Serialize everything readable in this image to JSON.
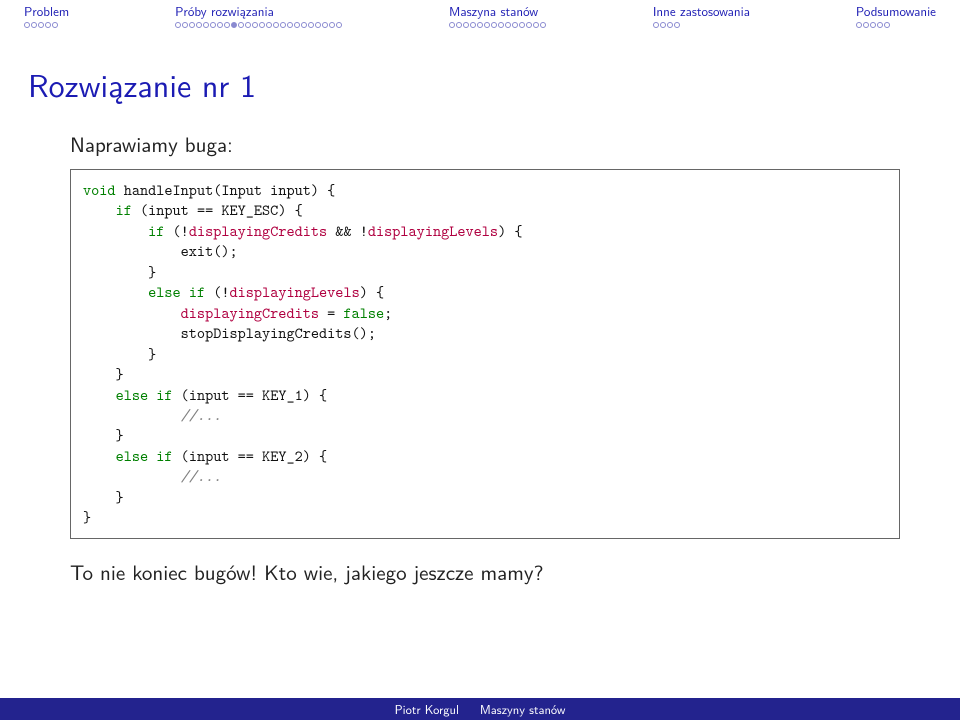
{
  "nav": {
    "items": [
      {
        "label": "Problem",
        "dots": 5,
        "filled": -1
      },
      {
        "label": "Próby rozwiązania",
        "dots": 24,
        "filled": 8
      },
      {
        "label": "Maszyna stanów",
        "dots": 14,
        "filled": -1
      },
      {
        "label": "Inne zastosowania",
        "dots": 4,
        "filled": -1
      },
      {
        "label": "Podsumowanie",
        "dots": 5,
        "filled": -1
      }
    ]
  },
  "title": "Rozwiązanie nr 1",
  "subtitle": "Naprawiamy buga:",
  "code": {
    "kw": {
      "void": "void",
      "if": "if",
      "else": "else",
      "false": "false"
    },
    "id": {
      "displayingCredits": "displayingCredits",
      "displayingLevels": "displayingLevels"
    },
    "cmt": "//...",
    "lines": {
      "l1a": " handleInput(Input input) {",
      "l2a": " (input == KEY_ESC) {",
      "l3a": " (!",
      "l3b": " && !",
      "l3c": ") {",
      "l4": "            exit();",
      "l5": "        }",
      "l6a": " (!",
      "l6b": ") {",
      "l7a": " = ",
      "l7b": ";",
      "l8": "            stopDisplayingCredits();",
      "l9": "        }",
      "l10": "    }",
      "l11a": " (input == KEY_1) {",
      "l12": "    }",
      "l13a": " (input == KEY_2) {",
      "l14": "    }",
      "l15": "}"
    }
  },
  "closing": "To nie koniec bugów! Kto wie, jakiego jeszcze mamy?",
  "footer": {
    "author": "Piotr Korgul",
    "talk": "Maszyny stanów"
  }
}
